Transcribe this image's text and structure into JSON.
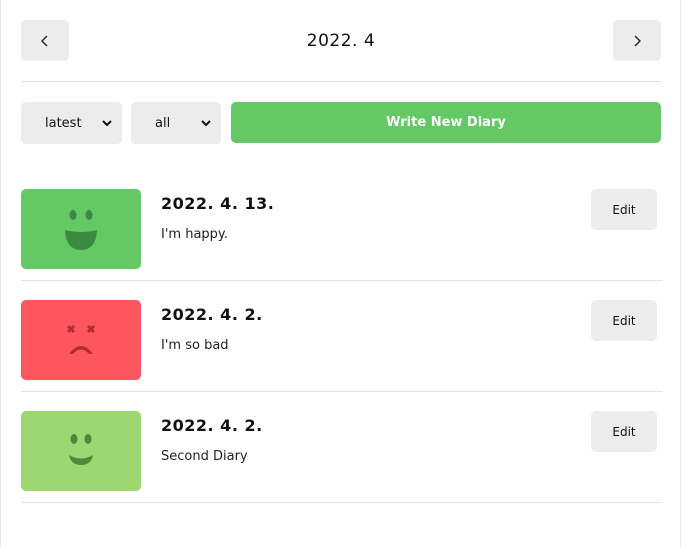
{
  "header": {
    "title": "2022. 4",
    "prev_icon": "chevron-left-icon",
    "next_icon": "chevron-right-icon"
  },
  "controls": {
    "sort_value": "latest",
    "filter_value": "all",
    "write_label": "Write New Diary"
  },
  "colors": {
    "accent": "#64c964",
    "happy": "#64c964",
    "bad": "#fd565f",
    "good": "#9dd772",
    "button_bg": "#ececec"
  },
  "diaries": [
    {
      "date": "2022. 4. 13.",
      "content": "I'm happy.",
      "emotion": "happy-face-icon",
      "edit_label": "Edit"
    },
    {
      "date": "2022. 4. 2.",
      "content": "I'm so bad",
      "emotion": "sad-face-icon",
      "edit_label": "Edit"
    },
    {
      "date": "2022. 4. 2.",
      "content": "Second Diary",
      "emotion": "smile-face-icon",
      "edit_label": "Edit"
    }
  ]
}
